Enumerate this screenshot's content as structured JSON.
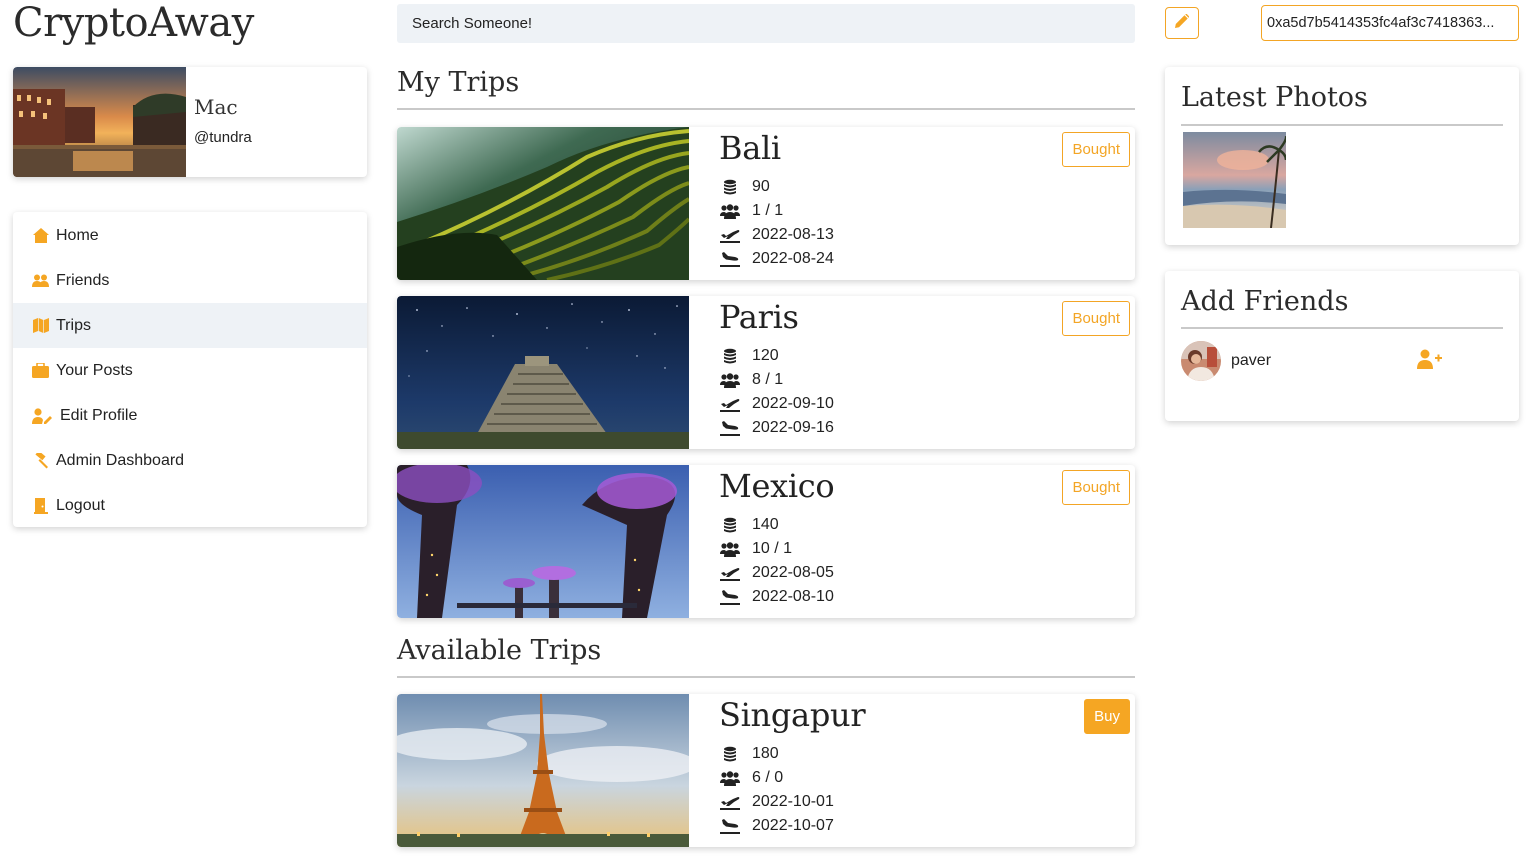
{
  "app": {
    "title": "CryptoAway"
  },
  "search": {
    "placeholder": "Search Someone!"
  },
  "profile": {
    "name": "Mac",
    "handle": "@tundra"
  },
  "menu": {
    "items": [
      {
        "label": "Home",
        "icon": "home-icon",
        "active": false
      },
      {
        "label": "Friends",
        "icon": "users-icon",
        "active": false
      },
      {
        "label": "Trips",
        "icon": "map-icon",
        "active": true
      },
      {
        "label": "Your Posts",
        "icon": "briefcase-icon",
        "active": false
      },
      {
        "label": "Edit Profile",
        "icon": "user-edit-icon",
        "active": false
      },
      {
        "label": "Admin Dashboard",
        "icon": "gavel-icon",
        "active": false
      },
      {
        "label": "Logout",
        "icon": "door-icon",
        "active": false
      }
    ]
  },
  "my_trips": {
    "title": "My Trips",
    "trips": [
      {
        "name": "Bali",
        "price": "90",
        "people": "1 / 1",
        "depart": "2022-08-13",
        "arrive": "2022-08-24",
        "status": "Bought",
        "image": "rice-terraces"
      },
      {
        "name": "Paris",
        "price": "120",
        "people": "8 / 1",
        "depart": "2022-09-10",
        "arrive": "2022-09-16",
        "status": "Bought",
        "image": "pyramid-night"
      },
      {
        "name": "Mexico",
        "price": "140",
        "people": "10 / 1",
        "depart": "2022-08-05",
        "arrive": "2022-08-10",
        "status": "Bought",
        "image": "supertrees"
      }
    ]
  },
  "available_trips": {
    "title": "Available Trips",
    "trips": [
      {
        "name": "Singapur",
        "price": "180",
        "people": "6 / 0",
        "depart": "2022-10-01",
        "arrive": "2022-10-07",
        "status": "Buy",
        "image": "eiffel-tower"
      }
    ]
  },
  "wallet": {
    "address": "0xa5d7b5414353fc4af3c7418363..."
  },
  "latest_photos": {
    "title": "Latest Photos"
  },
  "add_friends": {
    "title": "Add Friends",
    "suggestions": [
      {
        "name": "paver"
      }
    ]
  },
  "colors": {
    "accent": "#f5a623",
    "active_bg": "#eef2f6",
    "rule": "#c9c9c9"
  }
}
